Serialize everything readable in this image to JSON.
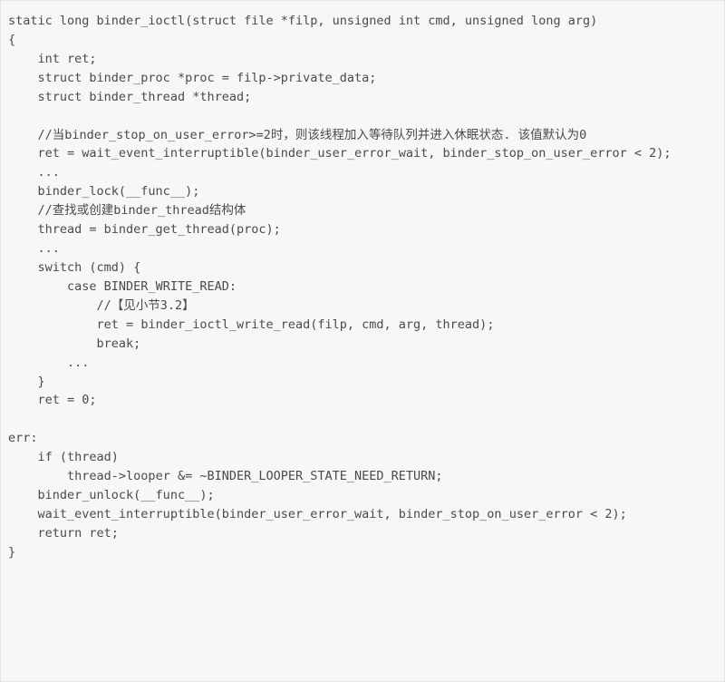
{
  "code": {
    "lines": [
      "static long binder_ioctl(struct file *filp, unsigned int cmd, unsigned long arg)",
      "{",
      "    int ret;",
      "    struct binder_proc *proc = filp->private_data;",
      "    struct binder_thread *thread;",
      "",
      "    //当binder_stop_on_user_error>=2时，则该线程加入等待队列并进入休眠状态. 该值默认为0",
      "    ret = wait_event_interruptible(binder_user_error_wait, binder_stop_on_user_error < 2);",
      "    ...",
      "    binder_lock(__func__);",
      "    //查找或创建binder_thread结构体",
      "    thread = binder_get_thread(proc);",
      "    ...",
      "    switch (cmd) {",
      "        case BINDER_WRITE_READ:",
      "            //【见小节3.2】",
      "            ret = binder_ioctl_write_read(filp, cmd, arg, thread);",
      "            break;",
      "        ...",
      "    }",
      "    ret = 0;",
      "",
      "err:",
      "    if (thread)",
      "        thread->looper &= ~BINDER_LOOPER_STATE_NEED_RETURN;",
      "    binder_unlock(__func__);",
      "    wait_event_interruptible(binder_user_error_wait, binder_stop_on_user_error < 2);",
      "    return ret;",
      "}"
    ]
  }
}
